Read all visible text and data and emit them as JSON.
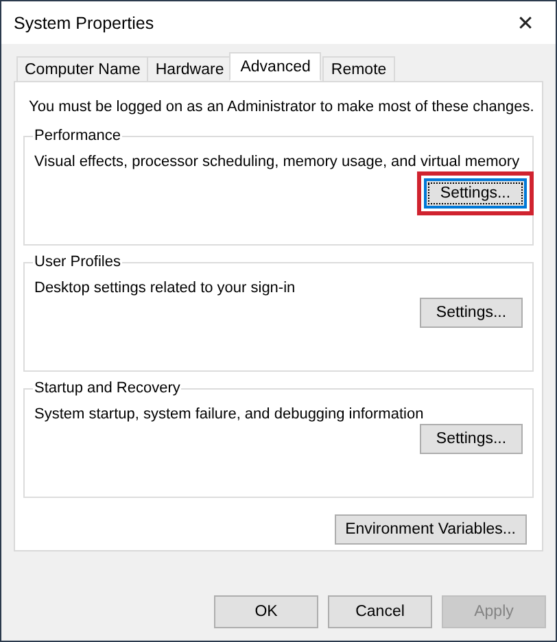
{
  "window": {
    "title": "System Properties",
    "close": "✕"
  },
  "tabs": [
    {
      "label": "Computer Name",
      "selected": false
    },
    {
      "label": "Hardware",
      "selected": false
    },
    {
      "label": "Advanced",
      "selected": true
    },
    {
      "label": "Remote",
      "selected": false
    }
  ],
  "notice": "You must be logged on as an Administrator to make most of these changes.",
  "groups": [
    {
      "title": "Performance",
      "description": "Visual effects, processor scheduling, memory usage, and virtual memory",
      "button": {
        "label": "Settings...",
        "focused": true,
        "highlighted": true
      }
    },
    {
      "title": "User Profiles",
      "description": "Desktop settings related to your sign-in",
      "button": {
        "label": "Settings...",
        "focused": false,
        "highlighted": false
      }
    },
    {
      "title": "Startup and Recovery",
      "description": "System startup, system failure, and debugging information",
      "button": {
        "label": "Settings...",
        "focused": false,
        "highlighted": false
      }
    }
  ],
  "environment_button": {
    "label": "Environment Variables...",
    "disabled": false
  },
  "buttons": [
    {
      "label": "OK",
      "disabled": false
    },
    {
      "label": "Cancel",
      "disabled": false
    },
    {
      "label": "Apply",
      "disabled": true
    }
  ]
}
